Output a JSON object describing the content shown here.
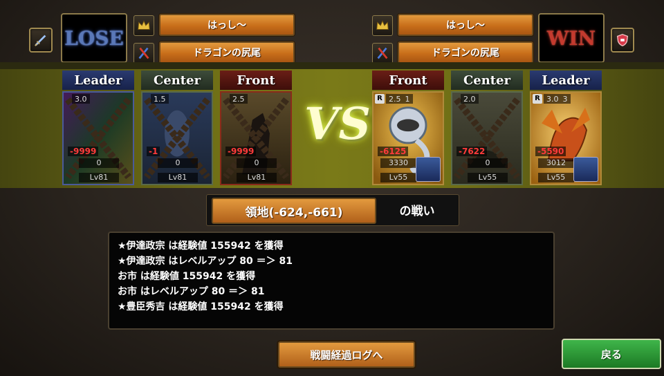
{
  "left": {
    "result": "LOSE",
    "player_name": "はっし～",
    "team_name": "ドラゴンの尻尾",
    "cards": [
      {
        "position": "Leader",
        "stat": "3.0",
        "damage": "-9999",
        "count": "0",
        "level": "Lv81"
      },
      {
        "position": "Center",
        "stat": "1.5",
        "damage": "-1",
        "count": "0",
        "level": "Lv81"
      },
      {
        "position": "Front",
        "stat": "2.5",
        "damage": "-9999",
        "count": "0",
        "level": "Lv81"
      }
    ]
  },
  "right": {
    "result": "WIN",
    "player_name": "はっし～",
    "team_name": "ドラゴンの尻尾",
    "cards": [
      {
        "position": "Front",
        "rarity": "R",
        "stat": "2.5",
        "sub": "1",
        "damage": "-6125",
        "count": "3330",
        "level": "Lv55"
      },
      {
        "position": "Center",
        "stat": "2.0",
        "damage": "-7622",
        "count": "0",
        "level": "Lv55"
      },
      {
        "position": "Leader",
        "rarity": "R",
        "stat": "3.0",
        "sub": "3",
        "damage": "-5590",
        "count": "3012",
        "level": "Lv55"
      }
    ]
  },
  "vs_label": "VS",
  "territory": {
    "label": "領地(-624,-661)",
    "suffix": "の戦い"
  },
  "log_lines": [
    "★伊達政宗 は経験値 155942 を獲得",
    "★伊達政宗 はレベルアップ 80 ＝＞ 81",
    "お市 は経験値 155942 を獲得",
    "お市 はレベルアップ 80 ＝＞ 81",
    "★豊臣秀吉 は経験値 155942 を獲得"
  ],
  "buttons": {
    "battle_log": "戦闘経過ログへ",
    "back": "戻る"
  },
  "icons": {
    "left_badge": "sword-icon",
    "right_badge": "shield-icon",
    "crown": "crown-icon",
    "team": "crossed-swords-icon"
  },
  "colors": {
    "accent_orange": "#c86e1a",
    "band": "#7a7a18",
    "back_green": "#2f9a3a",
    "damage_red": "#ff3b3b"
  }
}
